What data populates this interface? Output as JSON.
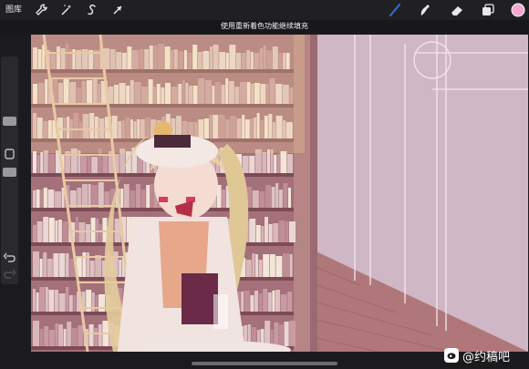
{
  "toolbar": {
    "gallery_label": "图库",
    "left_tools": [
      "wrench-icon",
      "magic-wand-icon",
      "selection-s-icon",
      "transform-arrow-icon"
    ],
    "right_tools": [
      "brush-icon",
      "smudge-icon",
      "eraser-icon",
      "layers-icon"
    ],
    "active_tool": "brush-icon",
    "color_swatch": "#f7a8cf",
    "active_color": "#2f6fe0"
  },
  "status": {
    "message": "使用重新着色功能继续填充"
  },
  "sidebar": {
    "items": [
      "brush-size-slider",
      "modify-button",
      "opacity-slider",
      "undo-icon",
      "redo-icon"
    ]
  },
  "watermark": {
    "text": "@约稿吧"
  }
}
